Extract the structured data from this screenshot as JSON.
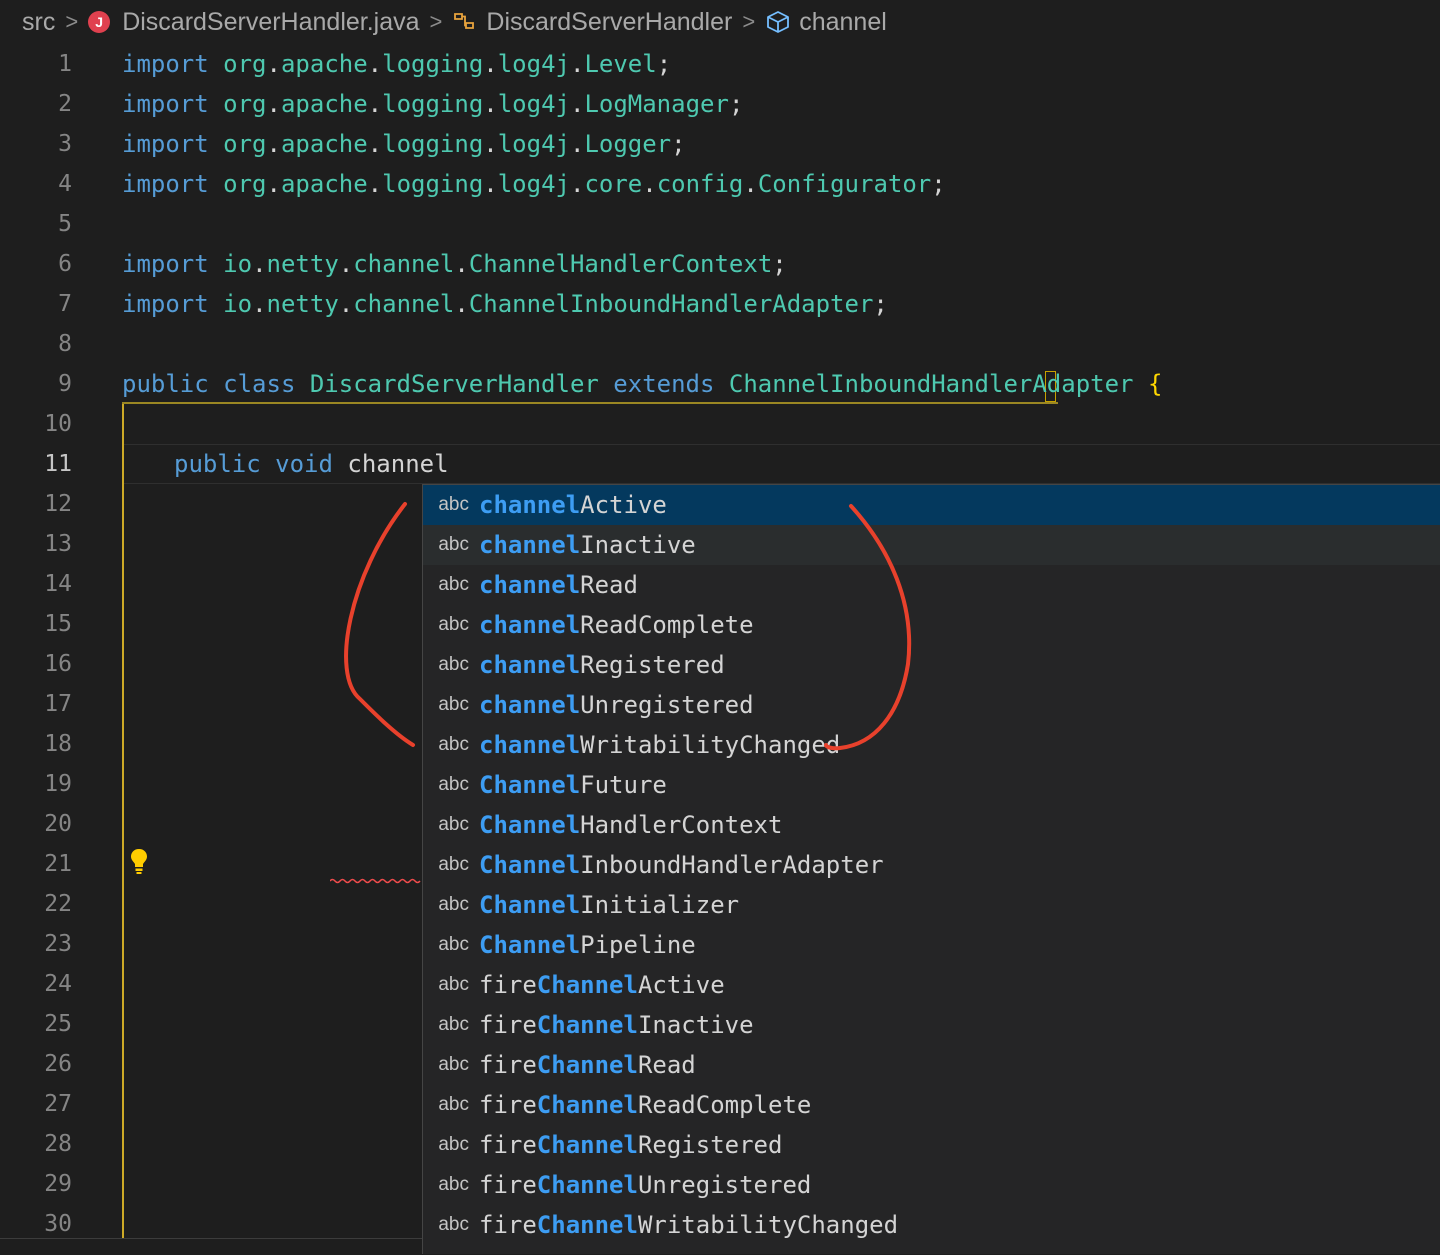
{
  "breadcrumb": {
    "folder": "src",
    "file": "DiscardServerHandler.java",
    "file_icon_letter": "J",
    "class": "DiscardServerHandler",
    "symbol": "channel"
  },
  "editor": {
    "current_line": 11,
    "lines": [
      {
        "n": "1"
      },
      {
        "n": "2"
      },
      {
        "n": "3"
      },
      {
        "n": "4"
      },
      {
        "n": "5"
      },
      {
        "n": "6"
      },
      {
        "n": "7"
      },
      {
        "n": "8"
      },
      {
        "n": "9"
      },
      {
        "n": "10"
      },
      {
        "n": "11"
      },
      {
        "n": "12"
      },
      {
        "n": "13"
      },
      {
        "n": "14"
      },
      {
        "n": "15"
      },
      {
        "n": "16"
      },
      {
        "n": "17"
      },
      {
        "n": "18"
      },
      {
        "n": "19"
      },
      {
        "n": "20"
      },
      {
        "n": "21"
      },
      {
        "n": "22"
      },
      {
        "n": "23"
      },
      {
        "n": "24"
      },
      {
        "n": "25"
      },
      {
        "n": "26"
      },
      {
        "n": "27"
      },
      {
        "n": "28"
      },
      {
        "n": "29"
      },
      {
        "n": "30"
      }
    ],
    "code": {
      "import_kw": "import",
      "l1": [
        "org",
        ".",
        "apache",
        ".",
        "logging",
        ".",
        "log4j",
        ".",
        "Level",
        ";"
      ],
      "l2": [
        "org",
        ".",
        "apache",
        ".",
        "logging",
        ".",
        "log4j",
        ".",
        "LogManager",
        ";"
      ],
      "l3": [
        "org",
        ".",
        "apache",
        ".",
        "logging",
        ".",
        "log4j",
        ".",
        "Logger",
        ";"
      ],
      "l4": [
        "org",
        ".",
        "apache",
        ".",
        "logging",
        ".",
        "log4j",
        ".",
        "core",
        ".",
        "config",
        ".",
        "Configurator",
        ";"
      ],
      "l6": [
        "io",
        ".",
        "netty",
        ".",
        "channel",
        ".",
        "ChannelHandlerContext",
        ";"
      ],
      "l7": [
        "io",
        ".",
        "netty",
        ".",
        "channel",
        ".",
        "ChannelInboundHandlerAdapter",
        ";"
      ],
      "l9_public": "public",
      "l9_class": "class",
      "l9_name": "DiscardServerHandler",
      "l9_extends": "extends",
      "l9_super": "ChannelInboundHandlerAdapter",
      "l9_brace": "{",
      "l11_public": "public",
      "l11_void": "void",
      "l11_ident": "channel"
    }
  },
  "suggestions": {
    "kind_label": "abc",
    "items": [
      {
        "pre": "",
        "match": "channel",
        "post": "Active"
      },
      {
        "pre": "",
        "match": "channel",
        "post": "Inactive"
      },
      {
        "pre": "",
        "match": "channel",
        "post": "Read"
      },
      {
        "pre": "",
        "match": "channel",
        "post": "ReadComplete"
      },
      {
        "pre": "",
        "match": "channel",
        "post": "Registered"
      },
      {
        "pre": "",
        "match": "channel",
        "post": "Unregistered"
      },
      {
        "pre": "",
        "match": "channel",
        "post": "WritabilityChanged"
      },
      {
        "pre": "",
        "match": "Channel",
        "post": "Future"
      },
      {
        "pre": "",
        "match": "Channel",
        "post": "HandlerContext"
      },
      {
        "pre": "",
        "match": "Channel",
        "post": "InboundHandlerAdapter"
      },
      {
        "pre": "",
        "match": "Channel",
        "post": "Initializer"
      },
      {
        "pre": "",
        "match": "Channel",
        "post": "Pipeline"
      },
      {
        "pre": "fire",
        "match": "Channel",
        "post": "Active"
      },
      {
        "pre": "fire",
        "match": "Channel",
        "post": "Inactive"
      },
      {
        "pre": "fire",
        "match": "Channel",
        "post": "Read"
      },
      {
        "pre": "fire",
        "match": "Channel",
        "post": "ReadComplete"
      },
      {
        "pre": "fire",
        "match": "Channel",
        "post": "Registered"
      },
      {
        "pre": "fire",
        "match": "Channel",
        "post": "Unregistered"
      },
      {
        "pre": "fire",
        "match": "Channel",
        "post": "WritabilityChanged"
      }
    ]
  },
  "colors": {
    "keyword": "#569cd6",
    "type": "#4ec9b0",
    "match_highlight": "#3d9df3",
    "selected_row": "#04395e",
    "annotation": "#e8412c"
  }
}
